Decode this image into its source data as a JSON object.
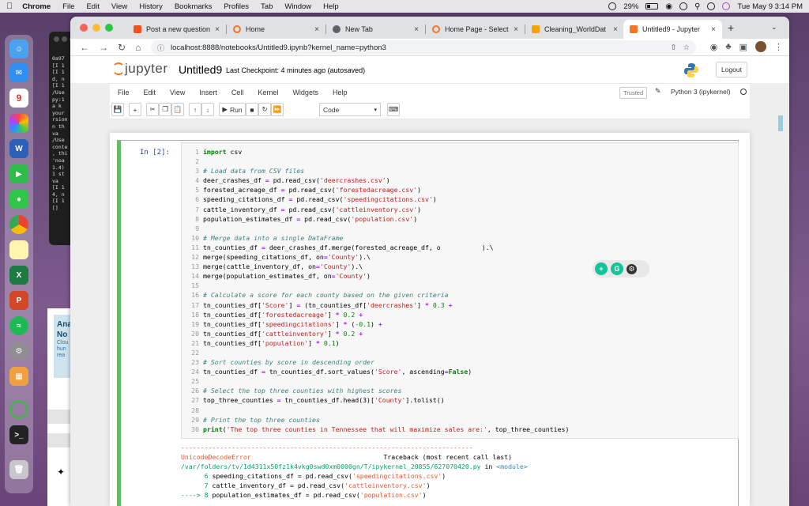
{
  "menubar": {
    "app": "Chrome",
    "items": [
      "File",
      "Edit",
      "View",
      "History",
      "Bookmarks",
      "Profiles",
      "Tab",
      "Window",
      "Help"
    ],
    "battery": "29%",
    "clock": "Tue May 9  3:14 PM"
  },
  "terminal": {
    "lines": [
      "0a97",
      "[I 1",
      "[I 1",
      "d, n",
      "[I 1",
      "/Use",
      "py:1",
      "a k",
      " your",
      "rsion",
      "n th",
      "  va",
      "/Use",
      "conte",
      ", thi",
      " 'noa",
      "1.4)",
      "1 st",
      "  va",
      "[I 1",
      "4, n",
      "[I 1",
      "[]"
    ]
  },
  "sidecard": {
    "title_line1": "Ana",
    "title_line2": "No",
    "sub": [
      "Clou",
      "hun",
      "rea"
    ]
  },
  "tabs": [
    {
      "label": "Post a new question",
      "close": "×",
      "favicon_color": "#f4511e"
    },
    {
      "label": "Home",
      "close": "×",
      "favicon_color": "#f37726"
    },
    {
      "label": "New Tab",
      "close": "×",
      "favicon_color": "#5f6368"
    },
    {
      "label": "Home Page - Select",
      "close": "×",
      "favicon_color": "#f37726"
    },
    {
      "label": "Cleaning_WorldDat",
      "close": "×",
      "favicon_color": "#f4a300"
    },
    {
      "label": "Untitled9 - Jupyter",
      "close": "×",
      "favicon_color": "#f37726"
    }
  ],
  "new_tab": "+",
  "address": "localhost:8888/notebooks/Untitled9.ipynb?kernel_name=python3",
  "jupyter": {
    "logo_text": "jupyter",
    "notebook_name": "Untitled9",
    "checkpoint": "Last Checkpoint: 4 minutes ago  (autosaved)",
    "logout": "Logout",
    "menu": [
      "File",
      "Edit",
      "View",
      "Insert",
      "Cell",
      "Kernel",
      "Widgets",
      "Help"
    ],
    "trusted": "Trusted",
    "kernel": "Python 3 (ipykernel)",
    "run_label": "Run",
    "cell_type": "Code"
  },
  "cell": {
    "prompt": "In [2]:",
    "line_numbers": [
      "1",
      "2",
      "3",
      "4",
      "5",
      "6",
      "7",
      "8",
      "9",
      "10",
      "11",
      "12",
      "13",
      "14",
      "15",
      "16",
      "17",
      "18",
      "19",
      "20",
      "21",
      "22",
      "23",
      "24",
      "25",
      "26",
      "27",
      "28",
      "29",
      "30"
    ]
  },
  "code_lines": [
    "import csv",
    "",
    "# Load data from CSV files",
    "deer_crashes_df = pd.read_csv('deercrashes.csv')",
    "forested_acreage_df = pd.read_csv('forestedacreage.csv')",
    "speeding_citations_df = pd.read_csv('speedingcitations.csv')",
    "cattle_inventory_df = pd.read_csv('cattleinventory.csv')",
    "population_estimates_df = pd.read_csv('population.csv')",
    "",
    "# Merge data into a single DataFrame",
    "tn_counties_df = deer_crashes_df.merge(forested_acreage_df, o",
    "merge(speeding_citations_df, on='County').\\",
    "merge(cattle_inventory_df, on='County').\\",
    "merge(population_estimates_df, on='County')",
    "",
    "# Calculate a score for each county based on the given criteria",
    "tn_counties_df['Score'] = (tn_counties_df['deercrashes'] * 0.3 +",
    "tn_counties_df['forestedacreage'] * 0.2 +",
    "tn_counties_df['speedingcitations'] * (-0.1) +",
    "tn_counties_df['cattleinventory'] * 0.2 +",
    "tn_counties_df['population'] * 0.1)",
    "",
    "# Sort counties by score in descending order",
    "tn_counties_df = tn_counties_df.sort_values('Score', ascending=False)",
    "",
    "# Select the top three counties with highest scores",
    "top_three_counties = tn_counties_df.head(3)['County'].tolist()",
    "",
    "# Print the top three counties",
    "print('The top three counties in Tennessee that will maximize sales are:', top_three_counties)"
  ],
  "line11_tail": ").\\",
  "error": {
    "divider": "---------------------------------------------------------------------------",
    "name": "UnicodeDecodeError",
    "traceback": "Traceback (most recent call last)",
    "path": "/var/folders/tv/1d4311x50fz1k4vkg0swd0xm0000gn/T/ipykernel_20855/627070420.py",
    "in": "in",
    "module": "<module>",
    "lines": [
      {
        "prefix": "      6 ",
        "code": "speeding_citations_df = pd.read_csv(",
        "arg": "'speedingcitations.csv'",
        "end": ")"
      },
      {
        "prefix": "      7 ",
        "code": "cattle_inventory_df = pd.read_csv(",
        "arg": "'cattleinventory.csv'",
        "end": ")"
      },
      {
        "prefix": "----> 8 ",
        "code": "population_estimates_df = pd.read_csv(",
        "arg": "'population.csv'",
        "end": ")"
      }
    ]
  },
  "colors": {
    "jupyter_orange": "#f37726",
    "cell_selected": "#66bb6a",
    "grammarly_green": "#15c39a"
  }
}
